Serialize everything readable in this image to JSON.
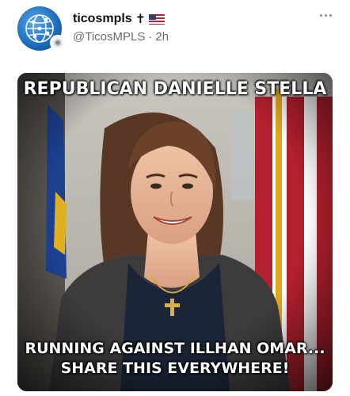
{
  "post": {
    "author": {
      "display_name": "ticosmpls",
      "handle": "@TicosMPLS",
      "separator": "·",
      "timestamp": "2h",
      "name_glyph": "✝",
      "name_emoji": "us-flag-icon",
      "avatar": "globe-network-icon"
    },
    "menu_icon": "more-horizontal-icon",
    "media": {
      "caption_top": "REPUBLICAN DANIELLE STELLA",
      "caption_bottom_line1": "RUNNING AGAINST ILLHAN OMAR...",
      "caption_bottom_line2": "SHARE THIS EVERYWHERE!"
    }
  },
  "colors": {
    "handle_gray": "#6b6b6b",
    "name_black": "#111111",
    "avatar_blue": "#1f6fc0"
  }
}
